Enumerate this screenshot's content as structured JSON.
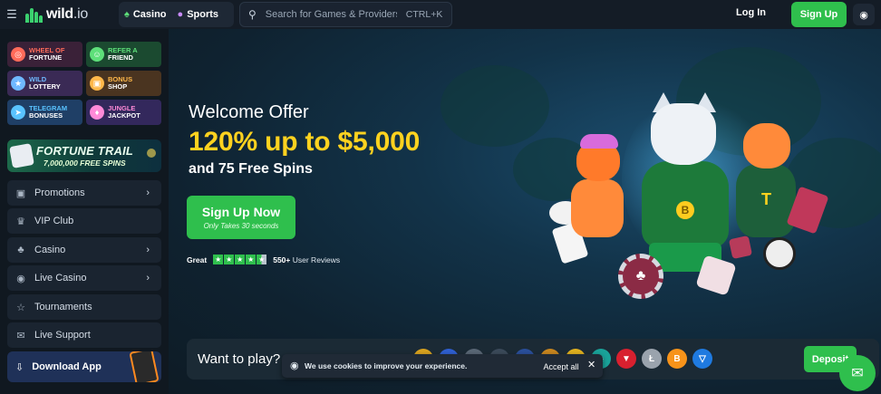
{
  "header": {
    "menu_icon": "hamburger-icon",
    "logo_text": "wild",
    "logo_suffix": ".io",
    "tabs": [
      {
        "label": "Casino",
        "icon": "casino-icon"
      },
      {
        "label": "Sports",
        "icon": "ball-icon"
      }
    ],
    "search_placeholder": "Search for Games & Providers",
    "search_shortcut": "CTRL+K",
    "login_label": "Log In",
    "signup_label": "Sign Up",
    "profile_icon": "account-icon"
  },
  "sidebar": {
    "promos": [
      {
        "top": "Wheel of",
        "bottom": "Fortune",
        "color": "#ff6b5a",
        "bg": "#3a2138"
      },
      {
        "top": "Refer a",
        "bottom": "Friend",
        "color": "#5ee07a",
        "bg": "#1b4a30"
      },
      {
        "top": "Wild",
        "bottom": "Lottery",
        "color": "#6fb8ff",
        "bg": "#3a2a55"
      },
      {
        "top": "Bonus",
        "bottom": "Shop",
        "color": "#ffb84a",
        "bg": "#4a3420"
      },
      {
        "top": "Telegram",
        "bottom": "Bonuses",
        "color": "#59c3ff",
        "bg": "#1f3f66"
      },
      {
        "top": "Jungle",
        "bottom": "Jackpot",
        "color": "#ff8ad8",
        "bg": "#33285c"
      }
    ],
    "fortune_trail": {
      "title": "FORTUNE TRAIL",
      "subtitle": "7,000,000 FREE SPINS"
    },
    "nav": [
      {
        "label": "Promotions",
        "icon": "gift-icon",
        "has_chevron": true
      },
      {
        "label": "VIP Club",
        "icon": "crown-icon",
        "has_chevron": false
      },
      {
        "label": "Casino",
        "icon": "casino-icon",
        "has_chevron": true
      },
      {
        "label": "Live Casino",
        "icon": "live-icon",
        "has_chevron": true
      },
      {
        "label": "Tournaments",
        "icon": "trophy-icon",
        "has_chevron": false
      },
      {
        "label": "Live Support",
        "icon": "chat-icon",
        "has_chevron": false
      }
    ],
    "download_label": "Download App"
  },
  "hero": {
    "welcome": "Welcome Offer",
    "offer": "120% up to $5,000",
    "spins": "and 75 Free Spins",
    "cta_label": "Sign Up Now",
    "cta_sub": "Only Takes 30 seconds",
    "rating_label": "Great",
    "rating_stars": 4.5,
    "review_count": "550+",
    "review_suffix": "User Reviews"
  },
  "play_bar": {
    "title": "Want to play?",
    "coins": [
      {
        "icon": "coin-gold-icon",
        "color": "#d8a21f"
      },
      {
        "icon": "coin-blue-icon",
        "color": "#2f5fd1"
      },
      {
        "icon": "coin-grey-icon",
        "color": "#5a6775"
      },
      {
        "icon": "coin-dark-icon",
        "color": "#3b4a5a"
      },
      {
        "icon": "coin-navy-icon",
        "color": "#2a4f9a"
      },
      {
        "icon": "coin-orange-icon",
        "color": "#c8861f"
      },
      {
        "icon": "coin-yellow-icon",
        "color": "#e0b01f"
      },
      {
        "icon": "coin-teal-icon",
        "color": "#1aa39a"
      },
      {
        "icon": "tron-icon",
        "color": "#d8202f"
      },
      {
        "icon": "litecoin-icon",
        "color": "#9aa3ad"
      },
      {
        "icon": "bitcoin-icon",
        "color": "#f7931a"
      },
      {
        "icon": "tether-icon",
        "color": "#1f7ae0"
      }
    ],
    "deposit_label": "Deposit"
  },
  "cookie": {
    "icon": "cookie-icon",
    "text": "We use cookies to improve your experience.",
    "accept_label": "Accept all",
    "close_icon": "close-icon"
  },
  "chat_icon": "chat-bubble-icon"
}
